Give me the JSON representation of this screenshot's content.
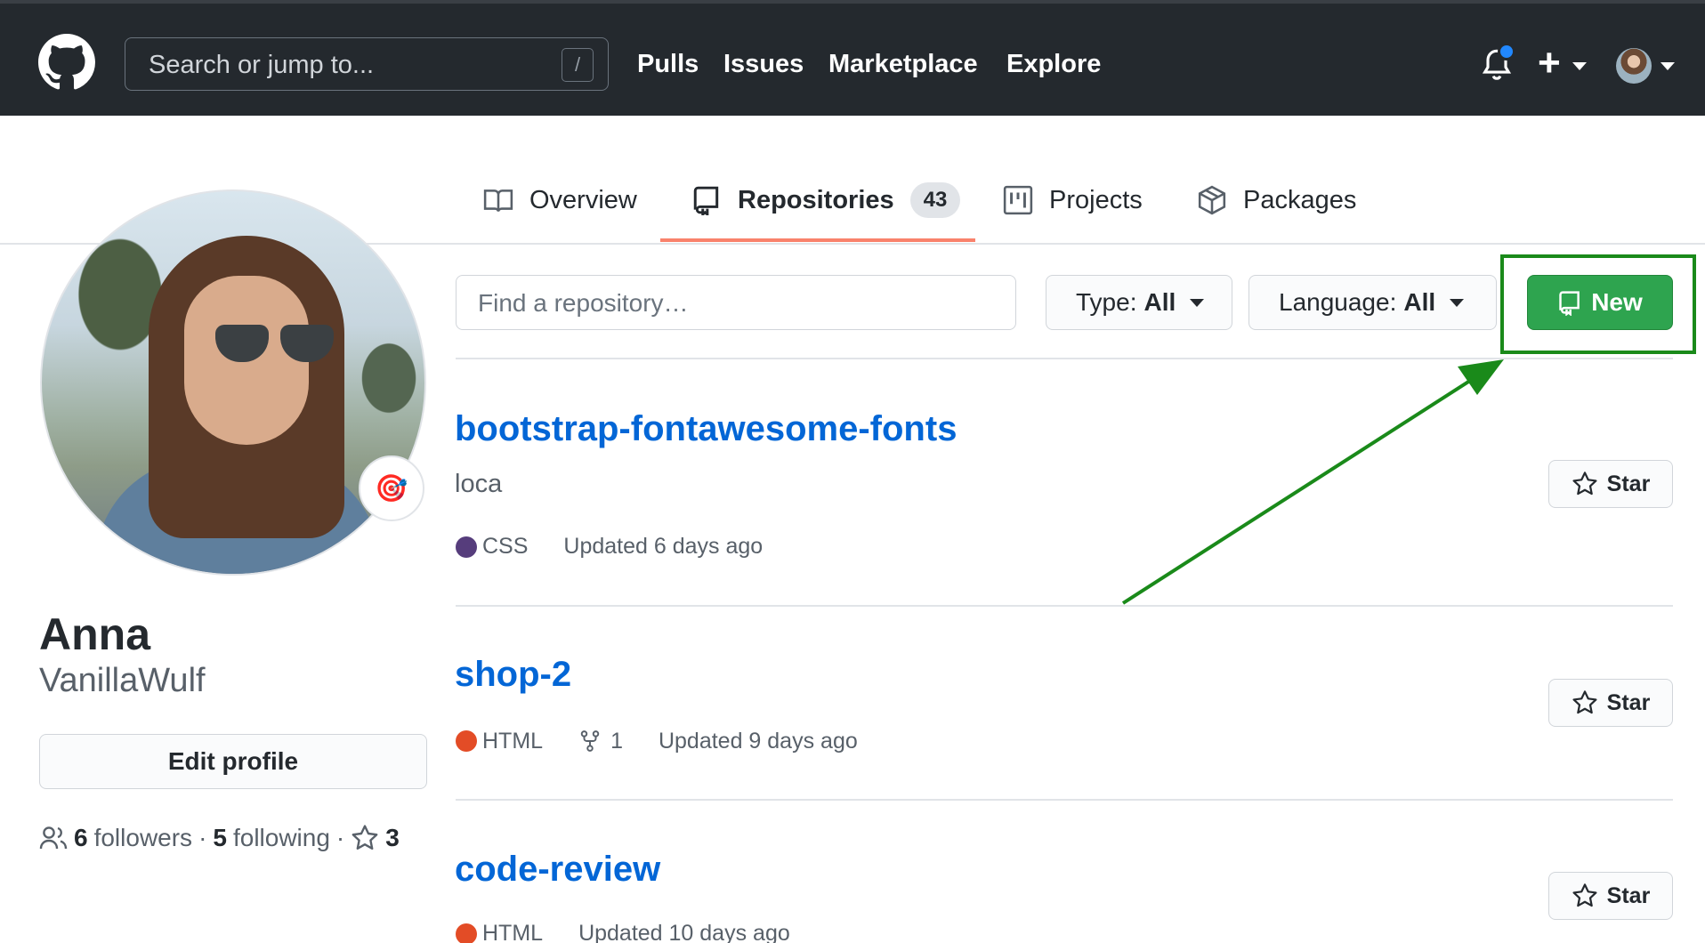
{
  "header": {
    "search_placeholder": "Search or jump to...",
    "search_shortcut": "/",
    "nav": [
      "Pulls",
      "Issues",
      "Marketplace",
      "Explore"
    ],
    "plus_label": "+"
  },
  "tabs": [
    {
      "label": "Overview",
      "icon": "book-icon"
    },
    {
      "label": "Repositories",
      "icon": "repo-icon",
      "count": "43",
      "selected": true
    },
    {
      "label": "Projects",
      "icon": "project-icon"
    },
    {
      "label": "Packages",
      "icon": "package-icon"
    }
  ],
  "profile": {
    "name": "Anna",
    "login": "VanillaWulf",
    "status_emoji": "🎯",
    "edit_label": "Edit profile",
    "followers_count": "6",
    "followers_label": "followers",
    "dot": "·",
    "following_count": "5",
    "following_label": "following",
    "stars_count": "3"
  },
  "filter": {
    "find_placeholder": "Find a repository…",
    "type_label": "Type:",
    "type_value": "All",
    "language_label": "Language:",
    "language_value": "All",
    "new_label": "New"
  },
  "repos": [
    {
      "name": "bootstrap-fontawesome-fonts",
      "description": "loca",
      "language": "CSS",
      "language_color": "#563d7c",
      "forks": "",
      "updated": "Updated 6 days ago",
      "star_label": "Star"
    },
    {
      "name": "shop-2",
      "description": "",
      "language": "HTML",
      "language_color": "#e34c26",
      "forks": "1",
      "updated": "Updated 9 days ago",
      "star_label": "Star"
    },
    {
      "name": "code-review",
      "description": "",
      "language": "HTML",
      "language_color": "#e34c26",
      "forks": "",
      "updated": "Updated 10 days ago",
      "star_label": "Star"
    }
  ],
  "colors": {
    "accent_green": "#2ea44f",
    "link_blue": "#0366d6",
    "highlight_green": "#1a8a1a",
    "tab_underline": "#f9826c"
  }
}
